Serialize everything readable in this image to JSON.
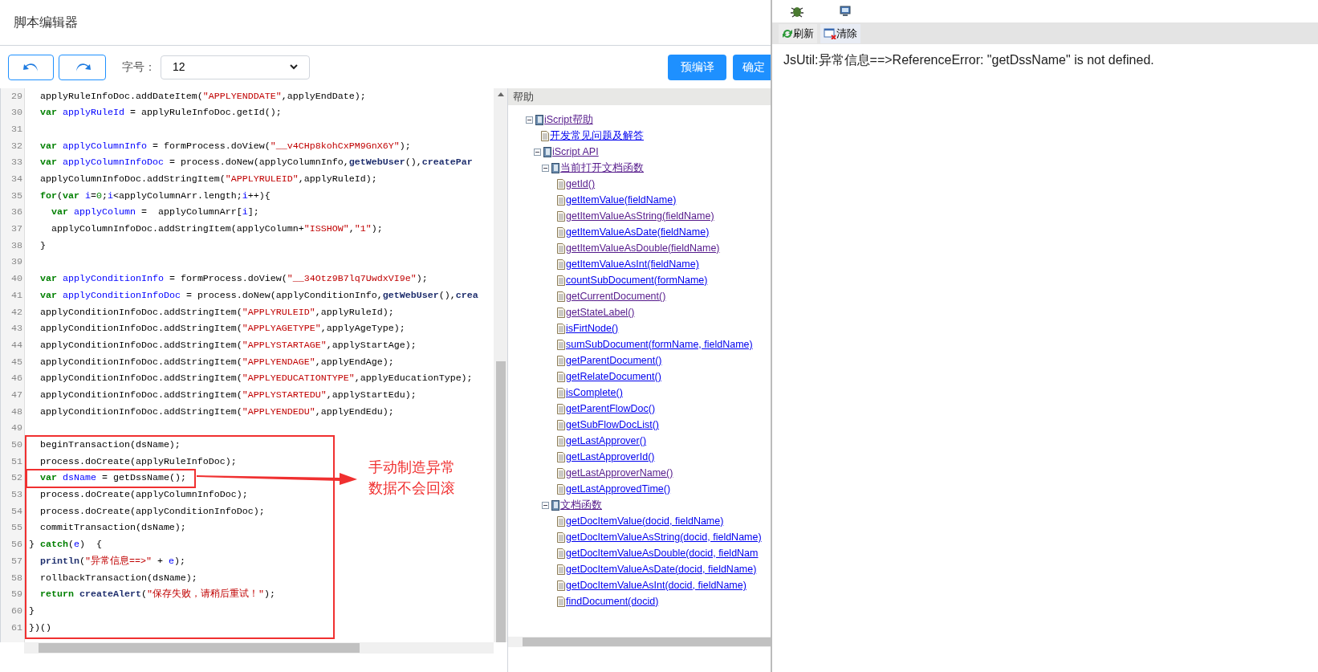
{
  "dialog": {
    "title": "脚本编辑器"
  },
  "toolbar": {
    "font_size_label": "字号：",
    "font_size_select": {
      "value": "12"
    },
    "buttons": [
      "预编译",
      "确定"
    ]
  },
  "code": {
    "lines": [
      {
        "number": "29",
        "tokens": [
          {
            "kind": "plain",
            "text": "  applyRuleInfoDoc.addDateItem("
          },
          {
            "kind": "string",
            "text": "\"APPLYENDDATE\""
          },
          {
            "kind": "plain",
            "text": ",applyEndDate);"
          }
        ]
      },
      {
        "number": "30",
        "tokens": [
          {
            "kind": "keyword",
            "text": "  var "
          },
          {
            "kind": "ident",
            "text": "applyRuleId"
          },
          {
            "kind": "plain",
            "text": " = applyRuleInfoDoc.getId();"
          }
        ]
      },
      {
        "number": "31"
      },
      {
        "number": "32",
        "tokens": [
          {
            "kind": "keyword",
            "text": "  var "
          },
          {
            "kind": "ident",
            "text": "applyColumnInfo"
          },
          {
            "kind": "plain",
            "text": " = formProcess.doView("
          },
          {
            "kind": "string",
            "text": "\"__v4CHp8kohCxPM9GnX6Y\""
          },
          {
            "kind": "plain",
            "text": ");"
          }
        ]
      },
      {
        "number": "33",
        "tokens": [
          {
            "kind": "keyword",
            "text": "  var "
          },
          {
            "kind": "ident",
            "text": "applyColumnInfoDoc"
          },
          {
            "kind": "plain",
            "text": " = process.doNew(applyColumnInfo,"
          },
          {
            "kind": "builtin",
            "text": "getWebUser"
          },
          {
            "kind": "plain",
            "text": "(),"
          },
          {
            "kind": "builtin",
            "text": "createPar"
          }
        ]
      },
      {
        "number": "34",
        "tokens": [
          {
            "kind": "plain",
            "text": "  applyColumnInfoDoc.addStringItem("
          },
          {
            "kind": "string",
            "text": "\"APPLYRULEID\""
          },
          {
            "kind": "plain",
            "text": ",applyRuleId);"
          }
        ]
      },
      {
        "number": "35",
        "tokens": [
          {
            "kind": "keyword",
            "text": "  for"
          },
          {
            "kind": "plain",
            "text": "("
          },
          {
            "kind": "keyword",
            "text": "var "
          },
          {
            "kind": "ident",
            "text": "i"
          },
          {
            "kind": "plain",
            "text": "="
          },
          {
            "kind": "number",
            "text": "0"
          },
          {
            "kind": "plain",
            "text": ";"
          },
          {
            "kind": "ident",
            "text": "i"
          },
          {
            "kind": "plain",
            "text": "<applyColumnArr.length;"
          },
          {
            "kind": "ident",
            "text": "i"
          },
          {
            "kind": "plain",
            "text": "++){"
          }
        ]
      },
      {
        "number": "36",
        "tokens": [
          {
            "kind": "keyword",
            "text": "    var "
          },
          {
            "kind": "ident",
            "text": "applyColumn"
          },
          {
            "kind": "plain",
            "text": " =  applyColumnArr["
          },
          {
            "kind": "ident",
            "text": "i"
          },
          {
            "kind": "plain",
            "text": "];"
          }
        ]
      },
      {
        "number": "37",
        "tokens": [
          {
            "kind": "plain",
            "text": "    applyColumnInfoDoc.addStringItem(applyColumn+"
          },
          {
            "kind": "string",
            "text": "\"ISSHOW\""
          },
          {
            "kind": "plain",
            "text": ","
          },
          {
            "kind": "string",
            "text": "\"1\""
          },
          {
            "kind": "plain",
            "text": ");"
          }
        ]
      },
      {
        "number": "38",
        "tokens": [
          {
            "kind": "plain",
            "text": "  }"
          }
        ]
      },
      {
        "number": "39"
      },
      {
        "number": "40",
        "tokens": [
          {
            "kind": "keyword",
            "text": "  var "
          },
          {
            "kind": "ident",
            "text": "applyConditionInfo"
          },
          {
            "kind": "plain",
            "text": " = formProcess.doView("
          },
          {
            "kind": "string",
            "text": "\"__34Otz9B7lq7UwdxVI9e\""
          },
          {
            "kind": "plain",
            "text": ");"
          }
        ]
      },
      {
        "number": "41",
        "tokens": [
          {
            "kind": "keyword",
            "text": "  var "
          },
          {
            "kind": "ident",
            "text": "applyConditionInfoDoc"
          },
          {
            "kind": "plain",
            "text": " = process.doNew(applyConditionInfo,"
          },
          {
            "kind": "builtin",
            "text": "getWebUser"
          },
          {
            "kind": "plain",
            "text": "(),"
          },
          {
            "kind": "builtin",
            "text": "crea"
          }
        ]
      },
      {
        "number": "42",
        "tokens": [
          {
            "kind": "plain",
            "text": "  applyConditionInfoDoc.addStringItem("
          },
          {
            "kind": "string",
            "text": "\"APPLYRULEID\""
          },
          {
            "kind": "plain",
            "text": ",applyRuleId);"
          }
        ]
      },
      {
        "number": "43",
        "tokens": [
          {
            "kind": "plain",
            "text": "  applyConditionInfoDoc.addStringItem("
          },
          {
            "kind": "string",
            "text": "\"APPLYAGETYPE\""
          },
          {
            "kind": "plain",
            "text": ",applyAgeType);"
          }
        ]
      },
      {
        "number": "44",
        "tokens": [
          {
            "kind": "plain",
            "text": "  applyConditionInfoDoc.addStringItem("
          },
          {
            "kind": "string",
            "text": "\"APPLYSTARTAGE\""
          },
          {
            "kind": "plain",
            "text": ",applyStartAge);"
          }
        ]
      },
      {
        "number": "45",
        "tokens": [
          {
            "kind": "plain",
            "text": "  applyConditionInfoDoc.addStringItem("
          },
          {
            "kind": "string",
            "text": "\"APPLYENDAGE\""
          },
          {
            "kind": "plain",
            "text": ",applyEndAge);"
          }
        ]
      },
      {
        "number": "46",
        "tokens": [
          {
            "kind": "plain",
            "text": "  applyConditionInfoDoc.addStringItem("
          },
          {
            "kind": "string",
            "text": "\"APPLYEDUCATIONTYPE\""
          },
          {
            "kind": "plain",
            "text": ",applyEducationType);"
          }
        ]
      },
      {
        "number": "47",
        "tokens": [
          {
            "kind": "plain",
            "text": "  applyConditionInfoDoc.addStringItem("
          },
          {
            "kind": "string",
            "text": "\"APPLYSTARTEDU\""
          },
          {
            "kind": "plain",
            "text": ",applyStartEdu);"
          }
        ]
      },
      {
        "number": "48",
        "tokens": [
          {
            "kind": "plain",
            "text": "  applyConditionInfoDoc.addStringItem("
          },
          {
            "kind": "string",
            "text": "\"APPLYENDEDU\""
          },
          {
            "kind": "plain",
            "text": ",applyEndEdu);"
          }
        ]
      },
      {
        "number": "49"
      },
      {
        "number": "50",
        "tokens": [
          {
            "kind": "plain",
            "text": "  beginTransaction(dsName);"
          }
        ]
      },
      {
        "number": "51",
        "tokens": [
          {
            "kind": "plain",
            "text": "  process.doCreate(applyRuleInfoDoc);"
          }
        ]
      },
      {
        "number": "52",
        "highlighted": true,
        "tokens": [
          {
            "kind": "keyword",
            "text": "  var "
          },
          {
            "kind": "ident",
            "text": "dsName"
          },
          {
            "kind": "plain",
            "text": " = getDssName();"
          }
        ]
      },
      {
        "number": "53",
        "tokens": [
          {
            "kind": "plain",
            "text": "  process.doCreate(applyColumnInfoDoc);"
          }
        ]
      },
      {
        "number": "54",
        "tokens": [
          {
            "kind": "plain",
            "text": "  process.doCreate(applyConditionInfoDoc);"
          }
        ]
      },
      {
        "number": "55",
        "tokens": [
          {
            "kind": "plain",
            "text": "  commitTransaction(dsName);"
          }
        ]
      },
      {
        "number": "56",
        "tokens": [
          {
            "kind": "plain",
            "text": "} "
          },
          {
            "kind": "keyword",
            "text": "catch"
          },
          {
            "kind": "plain",
            "text": "("
          },
          {
            "kind": "ident",
            "text": "e"
          },
          {
            "kind": "plain",
            "text": ")  {"
          }
        ]
      },
      {
        "number": "57",
        "tokens": [
          {
            "kind": "builtin",
            "text": "  println"
          },
          {
            "kind": "plain",
            "text": "("
          },
          {
            "kind": "string",
            "text": "\"异常信息==>\""
          },
          {
            "kind": "plain",
            "text": " + "
          },
          {
            "kind": "ident",
            "text": "e"
          },
          {
            "kind": "plain",
            "text": ");"
          }
        ]
      },
      {
        "number": "58",
        "tokens": [
          {
            "kind": "plain",
            "text": "  rollbackTransaction(dsName);"
          }
        ]
      },
      {
        "number": "59",
        "tokens": [
          {
            "kind": "keyword",
            "text": "  return "
          },
          {
            "kind": "builtin",
            "text": "createAlert"
          },
          {
            "kind": "plain",
            "text": "("
          },
          {
            "kind": "string",
            "text": "\"保存失败，请稍后重试！\""
          },
          {
            "kind": "plain",
            "text": ");"
          }
        ]
      },
      {
        "number": "60",
        "tokens": [
          {
            "kind": "plain",
            "text": "}"
          }
        ]
      },
      {
        "number": "61",
        "tokens": [
          {
            "kind": "plain",
            "text": "})()"
          }
        ]
      }
    ]
  },
  "annotation": {
    "lines": [
      "手动制造异常",
      "数据不会回滚"
    ]
  },
  "help": {
    "title": "帮助",
    "tree": [
      {
        "label": "iScript帮助",
        "visited": true,
        "expanded": true,
        "children": [
          {
            "label": "开发常见问题及解答",
            "visited": false
          },
          {
            "label": "iScript API",
            "visited": true,
            "expanded": true,
            "children": [
              {
                "label": "当前打开文档函数",
                "visited": true,
                "expanded": true,
                "children": [
                  {
                    "label": "getId()",
                    "visited": true
                  },
                  {
                    "label": "getItemValue(fieldName)",
                    "visited": false
                  },
                  {
                    "label": "getItemValueAsString(fieldName)",
                    "visited": true
                  },
                  {
                    "label": "getItemValueAsDate(fieldName)",
                    "visited": false
                  },
                  {
                    "label": "getItemValueAsDouble(fieldName)",
                    "visited": true
                  },
                  {
                    "label": "getItemValueAsInt(fieldName)",
                    "visited": false
                  },
                  {
                    "label": "countSubDocument(formName)",
                    "visited": false
                  },
                  {
                    "label": "getCurrentDocument()",
                    "visited": true
                  },
                  {
                    "label": "getStateLabel()",
                    "visited": true
                  },
                  {
                    "label": "isFirtNode()",
                    "visited": false
                  },
                  {
                    "label": "sumSubDocument(formName, fieldName)",
                    "visited": false
                  },
                  {
                    "label": "getParentDocument()",
                    "visited": false
                  },
                  {
                    "label": "getRelateDocument()",
                    "visited": false
                  },
                  {
                    "label": "isComplete()",
                    "visited": false
                  },
                  {
                    "label": "getParentFlowDoc()",
                    "visited": false
                  },
                  {
                    "label": "getSubFlowDocList()",
                    "visited": false
                  },
                  {
                    "label": "getLastApprover()",
                    "visited": false
                  },
                  {
                    "label": "getLastApproverId()",
                    "visited": false
                  },
                  {
                    "label": "getLastApproverName()",
                    "visited": true
                  },
                  {
                    "label": "getLastApprovedTime()",
                    "visited": false
                  }
                ]
              },
              {
                "label": "文档函数",
                "visited": true,
                "expanded": true,
                "children": [
                  {
                    "label": "getDocItemValue(docid, fieldName)",
                    "visited": false
                  },
                  {
                    "label": "getDocItemValueAsString(docid, fieldName)",
                    "visited": false
                  },
                  {
                    "label": "getDocItemValueAsDouble(docid, fieldNam",
                    "visited": false
                  },
                  {
                    "label": "getDocItemValueAsDate(docid, fieldName)",
                    "visited": false
                  },
                  {
                    "label": "getDocItemValueAsInt(docid, fieldName)",
                    "visited": false
                  },
                  {
                    "label": "findDocument(docid)",
                    "visited": false
                  }
                ]
              }
            ]
          }
        ]
      }
    ]
  },
  "console": {
    "buttons": [
      "刷新",
      "清除"
    ],
    "message": "JsUtil:异常信息==>ReferenceError: \"getDssName\" is not defined."
  }
}
